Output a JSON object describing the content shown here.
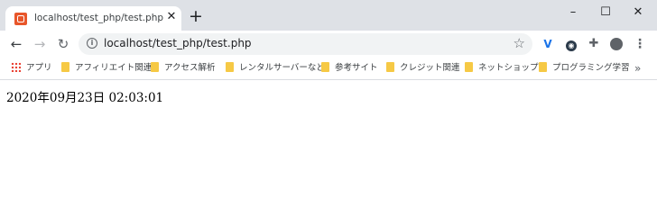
{
  "tab": {
    "title": "localhost/test_php/test.php",
    "close": "✕",
    "new_tab": "+"
  },
  "window": {
    "minimize": "–",
    "maximize": "☐",
    "close": "✕"
  },
  "toolbar": {
    "back": "←",
    "forward": "→",
    "reload": "↻",
    "url": "localhost/test_php/test.php",
    "info": "i",
    "star": "☆",
    "menu": "⋮"
  },
  "bookmarks": {
    "items": [
      {
        "label": "アプリ"
      },
      {
        "label": "アフィリエイト関連"
      },
      {
        "label": "アクセス解析"
      },
      {
        "label": "レンタルサーバーなど"
      },
      {
        "label": "参考サイト"
      },
      {
        "label": "クレジット関連"
      },
      {
        "label": "ネットショップ"
      },
      {
        "label": "プログラミング学習"
      }
    ],
    "more": "»"
  },
  "page": {
    "text": "2020年09月23日 02:03:01"
  }
}
